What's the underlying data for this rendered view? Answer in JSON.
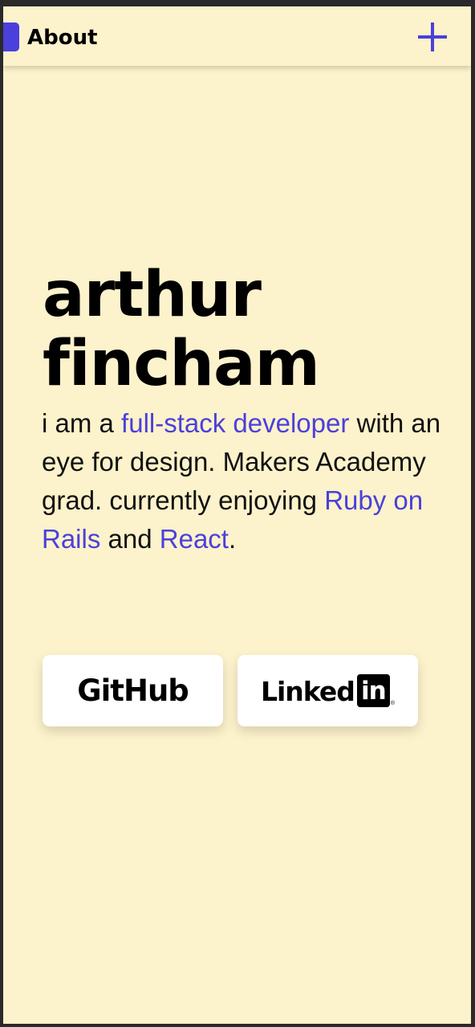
{
  "colors": {
    "background": "#fcf2cb",
    "accent": "#4b40db",
    "text": "#000000"
  },
  "header": {
    "title": "About",
    "menu_icon": "plus-icon"
  },
  "hero": {
    "name_line1": "arthur",
    "name_line2": "fincham"
  },
  "bio": {
    "t1": "i am a ",
    "link_fullstack": "full-stack developer",
    "t2": " with an eye for design. Makers Academy grad. currently enjoying ",
    "link_rails": "Ruby on Rails",
    "t3": " and ",
    "link_react": "React",
    "t4": "."
  },
  "social": {
    "github": {
      "label": "GitHub",
      "icon": "github-logo"
    },
    "linkedin": {
      "label_text": "Linked",
      "label_box": "in",
      "registered": "®",
      "icon": "linkedin-logo"
    }
  }
}
